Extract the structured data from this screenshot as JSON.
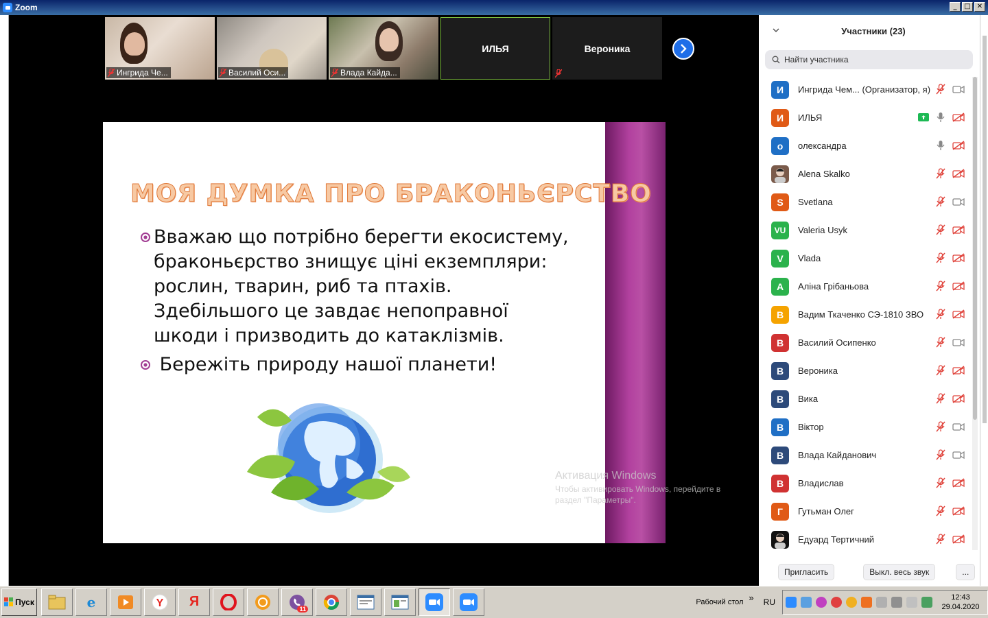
{
  "window": {
    "title": "Zoom",
    "min": "_",
    "max": "□",
    "close": "✕"
  },
  "video_strip": {
    "tiles": [
      {
        "label": "Ингрида Че..."
      },
      {
        "label": "Василий Оси..."
      },
      {
        "label": "Влада Кайда..."
      },
      {
        "label": "ИЛЬЯ"
      },
      {
        "label": "Вероника"
      }
    ]
  },
  "slide": {
    "title": "МОЯ ДУМКА ПРО БРАКОНЬЄРСТВО",
    "bullets": [
      "Вважаю що потрібно берегти екосистему, браконьєрство знищує ціні екземпляри: рослин, тварин, риб та птахів. Здебільшого це завдає непоправної шкоди і призводить до катаклізмів.",
      " Бережіть природу нашої планети!"
    ]
  },
  "watermark": {
    "title": "Активация Windows",
    "text": "Чтобы активировать Windows, перейдите в раздел \"Параметры\"."
  },
  "panel": {
    "title": "Участники (23)",
    "search_placeholder": "Найти участника",
    "participants": [
      {
        "initial": "И",
        "name": "Ингрида Чем...  (Организатор, я)",
        "color": "#1f6fc5",
        "mic": "off",
        "video": "on"
      },
      {
        "initial": "И",
        "name": "ИЛЬЯ",
        "color": "#e05a16",
        "mic": "on",
        "video": "off",
        "sharing": true
      },
      {
        "initial": "о",
        "name": "олександра",
        "color": "#1f6fc5",
        "mic": "on",
        "video": "off"
      },
      {
        "initial": "",
        "name": "Alena Skalko",
        "color": "#7a5a4a",
        "mic": "off",
        "video": "off"
      },
      {
        "initial": "S",
        "name": "Svetlana",
        "color": "#e05a16",
        "mic": "off",
        "video": "on"
      },
      {
        "initial": "VU",
        "name": "Valeria Usyk",
        "color": "#2bb24c",
        "mic": "off",
        "video": "off"
      },
      {
        "initial": "V",
        "name": "Vlada",
        "color": "#2bb24c",
        "mic": "off",
        "video": "off"
      },
      {
        "initial": "А",
        "name": "Аліна Грібаньова",
        "color": "#2bb24c",
        "mic": "off",
        "video": "off"
      },
      {
        "initial": "В",
        "name": "Вадим Ткаченко СЭ-1810 ЗВО",
        "color": "#f5a300",
        "mic": "off",
        "video": "off"
      },
      {
        "initial": "В",
        "name": "Василий Осипенко",
        "color": "#d03232",
        "mic": "off",
        "video": "on"
      },
      {
        "initial": "В",
        "name": "Вероника",
        "color": "#2d4a7a",
        "mic": "off",
        "video": "off"
      },
      {
        "initial": "В",
        "name": "Вика",
        "color": "#2d4a7a",
        "mic": "off",
        "video": "off"
      },
      {
        "initial": "В",
        "name": "Віктор",
        "color": "#1f6fc5",
        "mic": "off",
        "video": "on"
      },
      {
        "initial": "В",
        "name": "Влада Кайданович",
        "color": "#2d4a7a",
        "mic": "off",
        "video": "on"
      },
      {
        "initial": "В",
        "name": "Владислав",
        "color": "#d03232",
        "mic": "off",
        "video": "off"
      },
      {
        "initial": "Г",
        "name": "Гутьман Олег",
        "color": "#e05a16",
        "mic": "off",
        "video": "off"
      },
      {
        "initial": "",
        "name": "Едуард Тертичний",
        "color": "#111111",
        "mic": "off",
        "video": "off"
      }
    ],
    "invite_label": "Пригласить",
    "mute_all_label": "Выкл. весь звук",
    "more_label": "..."
  },
  "taskbar": {
    "start_label": "Пуск",
    "desktop_label": "Рабочий стол",
    "chevron": "»",
    "lang": "RU",
    "time": "12:43",
    "date": "29.04.2020",
    "viber_badge": "11"
  }
}
